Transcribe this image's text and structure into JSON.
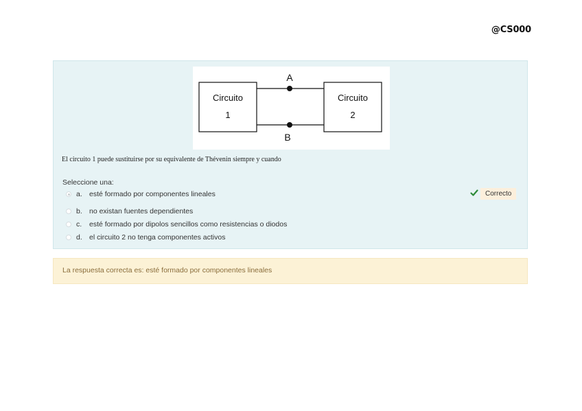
{
  "header": {
    "handle": "@CS000"
  },
  "question": {
    "figure": {
      "box1_line1": "Circuito",
      "box1_line2": "1",
      "box2_line1": "Circuito",
      "box2_line2": "2",
      "terminal_a": "A",
      "terminal_b": "B"
    },
    "text": "El circuito 1 puede sustituirse por su equivalente de Thévenin siempre y cuando",
    "prompt": "Seleccione una:",
    "options": [
      {
        "letter": "a.",
        "text": "esté formado por componentes lineales",
        "selected": true
      },
      {
        "letter": "b.",
        "text": "no existan fuentes dependientes",
        "selected": false
      },
      {
        "letter": "c.",
        "text": "esté formado por dipolos sencillos como resistencias o diodos",
        "selected": false
      },
      {
        "letter": "d.",
        "text": "el circuito 2 no tenga componentes activos",
        "selected": false
      }
    ],
    "status_icon": "check-icon",
    "status_label": "Correcto"
  },
  "feedback": {
    "text": "La respuesta correcta es: esté formado por componentes lineales"
  },
  "colors": {
    "question_bg": "#e7f3f5",
    "feedback_bg": "#fcf2d6",
    "feedback_text": "#8a6d3b",
    "check_green": "#2e8b3a",
    "badge_bg": "#fcefdc"
  }
}
